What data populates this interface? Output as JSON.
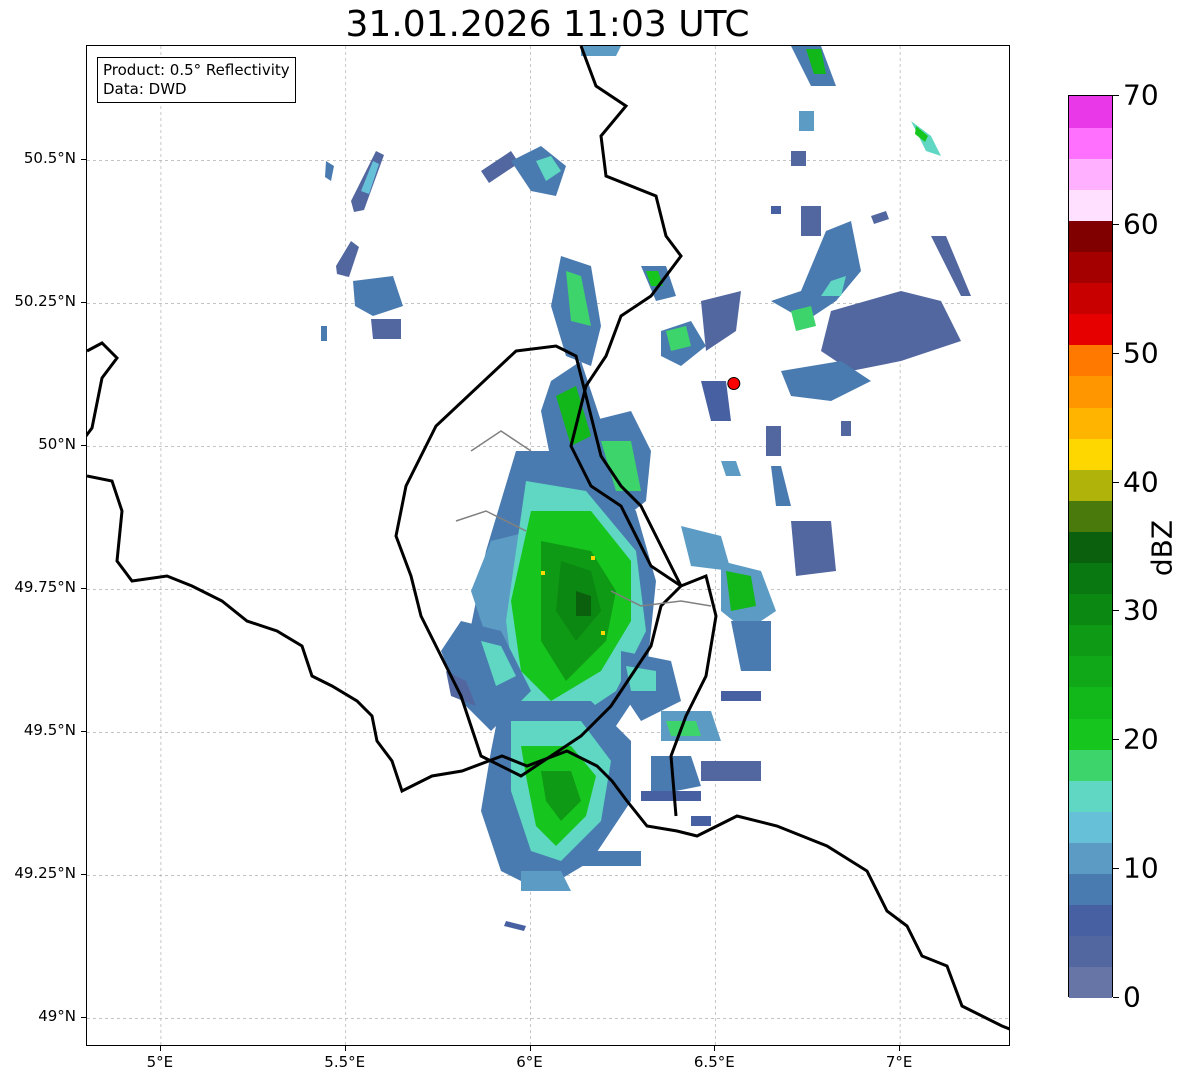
{
  "title": "31.01.2026 11:03 UTC",
  "info_box": {
    "product": "Product: 0.5° Reflectivity",
    "data": "Data: DWD"
  },
  "map": {
    "lon_range": [
      4.8,
      7.3
    ],
    "lat_range": [
      48.95,
      50.7
    ],
    "x_ticks": [
      {
        "value": 5.0,
        "label": "5°E"
      },
      {
        "value": 5.5,
        "label": "5.5°E"
      },
      {
        "value": 6.0,
        "label": "6°E"
      },
      {
        "value": 6.5,
        "label": "6.5°E"
      },
      {
        "value": 7.0,
        "label": "7°E"
      }
    ],
    "y_ticks": [
      {
        "value": 50.5,
        "label": "50.5°N"
      },
      {
        "value": 50.25,
        "label": "50.25°N"
      },
      {
        "value": 50.0,
        "label": "50°N"
      },
      {
        "value": 49.75,
        "label": "49.75°N"
      },
      {
        "value": 49.5,
        "label": "49.5°N"
      },
      {
        "value": 49.25,
        "label": "49.25°N"
      },
      {
        "value": 49.0,
        "label": "49°N"
      }
    ],
    "grid": true,
    "radar_site": {
      "lon": 6.55,
      "lat": 50.11,
      "color": "#ff0000"
    }
  },
  "colorbar": {
    "unit": "dBZ",
    "min": 0,
    "max": 70,
    "ticks": [
      {
        "value": 0,
        "label": "0"
      },
      {
        "value": 10,
        "label": "10"
      },
      {
        "value": 20,
        "label": "20"
      },
      {
        "value": 30,
        "label": "30"
      },
      {
        "value": 40,
        "label": "40"
      },
      {
        "value": 50,
        "label": "50"
      },
      {
        "value": 60,
        "label": "60"
      },
      {
        "value": 70,
        "label": "70"
      }
    ],
    "colors": [
      "#6674a6",
      "#5267a0",
      "#4660a2",
      "#4a7bb0",
      "#5b9bc4",
      "#66c0d8",
      "#5fd7c2",
      "#3dd46c",
      "#16c61e",
      "#12b81a",
      "#10a818",
      "#0e9a14",
      "#0b8812",
      "#0a7810",
      "#0a600c",
      "#4a7a0c",
      "#b0b40a",
      "#ffd700",
      "#ffb400",
      "#ff9600",
      "#ff7800",
      "#e60000",
      "#c80000",
      "#a50000",
      "#800000",
      "#ffe0ff",
      "#ffb0ff",
      "#ff70ff",
      "#e838e8"
    ]
  }
}
